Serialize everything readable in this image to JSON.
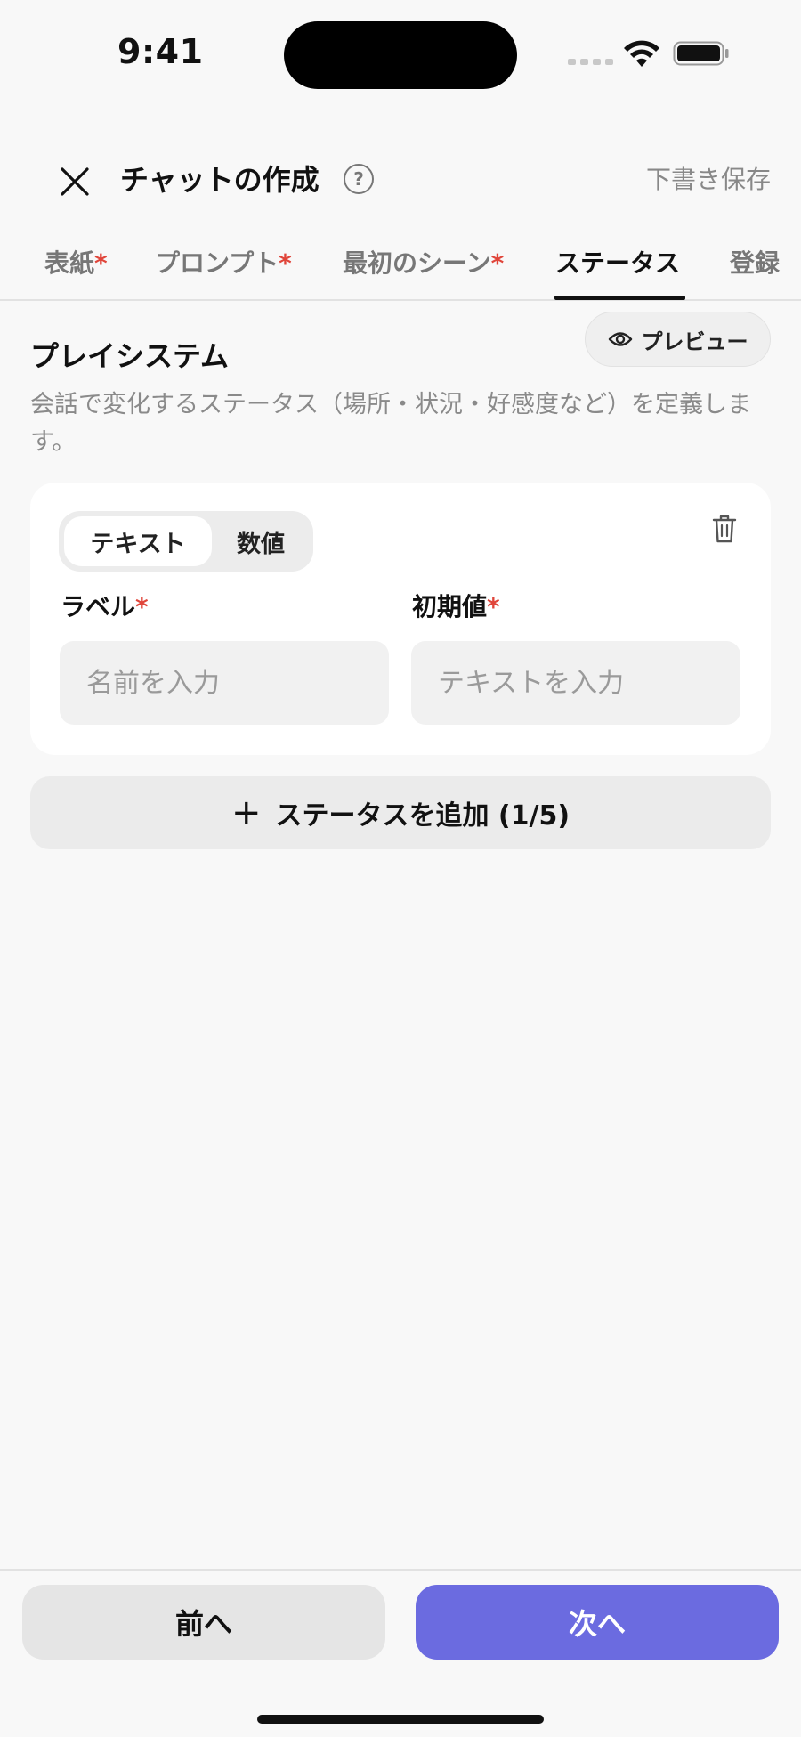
{
  "status_bar": {
    "time": "9:41"
  },
  "header": {
    "title": "チャットの作成",
    "help_glyph": "?",
    "draft_save": "下書き保存"
  },
  "tabs": [
    {
      "label": "表紙",
      "required": "*"
    },
    {
      "label": "プロンプト",
      "required": "*"
    },
    {
      "label": "最初のシーン",
      "required": "*"
    },
    {
      "label": "ステータス",
      "required": ""
    },
    {
      "label": "登録",
      "required": ""
    }
  ],
  "active_tab": "ステータス",
  "section": {
    "title": "プレイシステム",
    "description": "会話で変化するステータス（場所・状況・好感度など）を定義します。",
    "preview_label": "プレビュー"
  },
  "status_card": {
    "type_options": [
      "テキスト",
      "数値"
    ],
    "selected_type": "テキスト",
    "label_field": {
      "label": "ラベル",
      "required": "*",
      "placeholder": "名前を入力",
      "value": ""
    },
    "initial_field": {
      "label": "初期値",
      "required": "*",
      "placeholder": "テキストを入力",
      "value": ""
    }
  },
  "add_status": {
    "plus": "+",
    "label": "ステータスを追加 (1/5)"
  },
  "footer": {
    "prev_label": "前へ",
    "next_label": "次へ"
  },
  "colors": {
    "accent": "#6b6be0",
    "required": "#e0453a",
    "background": "#f8f8f8"
  },
  "icons": [
    "close-icon",
    "help-icon",
    "eye-icon",
    "trash-icon",
    "plus-icon",
    "wifi-icon",
    "battery-icon"
  ]
}
